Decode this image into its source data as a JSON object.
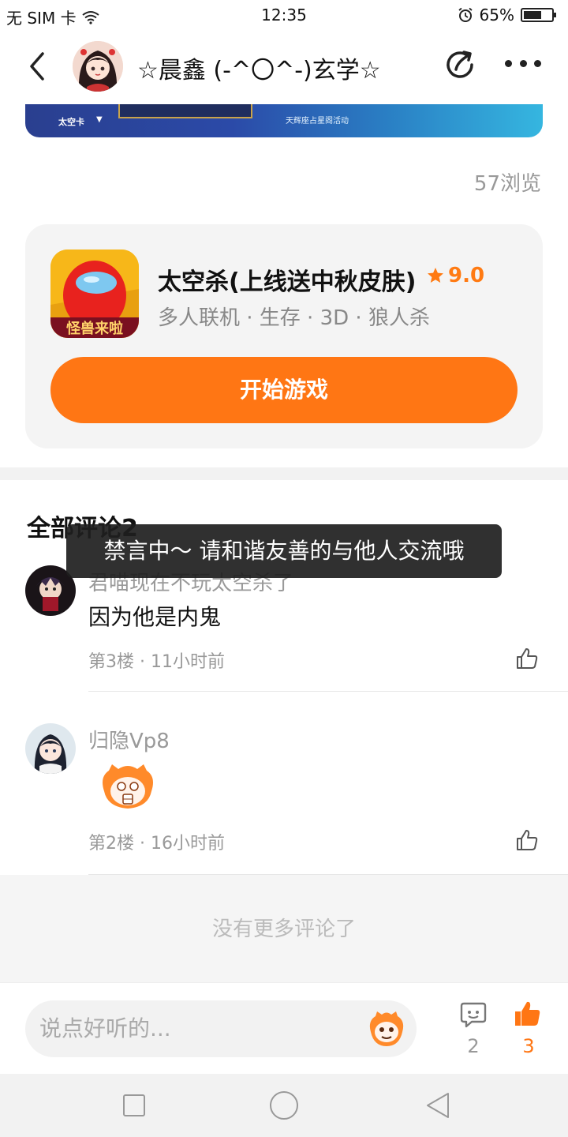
{
  "status_bar": {
    "carrier": "无 SIM 卡",
    "time": "12:35",
    "battery_percent": "65%",
    "battery_level": 0.65
  },
  "nav": {
    "title": "☆晨鑫 (-^〇^-)玄学☆"
  },
  "banner": {
    "label": "太空卡",
    "subtext": "天辉座占星阁活动"
  },
  "post": {
    "views": "57浏览"
  },
  "game_card": {
    "title": "太空杀(上线送中秋皮肤)",
    "rating": "9.0",
    "tags": "多人联机 · 生存 · 3D · 狼人杀",
    "play_label": "开始游戏",
    "icon_caption": "怪兽来啦"
  },
  "comments": {
    "heading": "全部评论2",
    "items": [
      {
        "user": "君喵现在不玩太空杀了",
        "text": "因为他是内鬼",
        "meta": "第3楼 · 11小时前"
      },
      {
        "user": "归隐Vp8",
        "text": "",
        "meta": "第2楼 · 16小时前"
      }
    ],
    "no_more": "没有更多评论了"
  },
  "toast": {
    "message": "禁言中～ 请和谐友善的与他人交流哦"
  },
  "bottom_bar": {
    "input_placeholder": "说点好听的...",
    "comment_count": "2",
    "like_count": "3"
  },
  "colors": {
    "accent": "#ff7614",
    "rating_star": "#ff7a12"
  }
}
